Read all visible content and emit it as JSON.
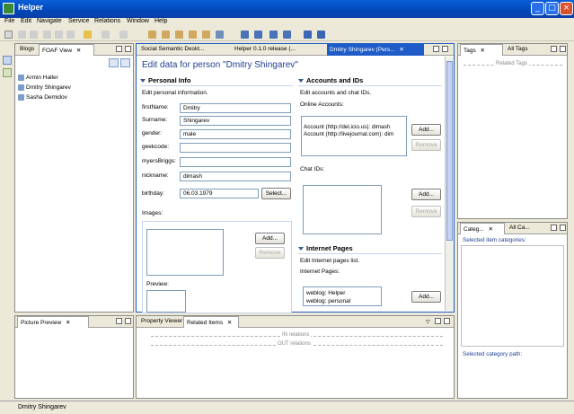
{
  "window": {
    "title": "Helper",
    "minimize": "_",
    "maximize": "□",
    "close": "×"
  },
  "menu": [
    "File",
    "Edit",
    "Navigate",
    "Service",
    "Relations",
    "Window",
    "Help"
  ],
  "left_panel": {
    "tabs": [
      "Blogs",
      "FOAF View"
    ],
    "persons": [
      "Armin Haller",
      "Dmitry Shingarev",
      "Sasha Demidov"
    ]
  },
  "editor_tabs": [
    "Social Semantic Deskt...",
    "Helper 0.1.0 release (...",
    "Dmitry Shingarev (Pers..."
  ],
  "editor": {
    "heading": "Edit data for person \"Dmitry Shingarev\"",
    "personal": {
      "title": "Personal Info",
      "desc": "Edit personal information.",
      "labels": [
        "firstName:",
        "Surname:",
        "gender:",
        "geekcode:",
        "myersBriggs:",
        "nickname:"
      ],
      "values": [
        "Dmitry",
        "Shingarev",
        "male",
        "",
        "",
        "dimash"
      ],
      "birthday_label": "birthday:",
      "birthday_value": "06.03.1979",
      "select_button": "Select...",
      "images_label": "Images:",
      "add": "Add...",
      "remove": "Remove",
      "preview_label": "Preview:"
    },
    "accounts": {
      "title": "Accounts and IDs",
      "desc": "Edit accounts and chat IDs.",
      "online_label": "Online Accounts:",
      "online_items": [
        "Account (http://del.icio.us): dimash",
        "Account (http://livejournal.com): dim"
      ],
      "add": "Add...",
      "remove": "Remove",
      "chat_label": "Chat IDs:",
      "chat_add": "Add...",
      "chat_remove": "Remove"
    },
    "internet": {
      "title": "Internet Pages",
      "desc": "Edit Internet pages list.",
      "pages_label": "Internet Pages:",
      "pages": [
        "weblog: Helper",
        "weblog: personal"
      ],
      "add": "Add..."
    }
  },
  "right_top": {
    "tabs": [
      "Tags",
      "All Tags"
    ],
    "related_tags": "Related Tags"
  },
  "right_bottom": {
    "tabs": [
      "Categ...",
      "All Ca..."
    ],
    "selected_categories": "Selected item categories:",
    "selected_path": "Selected category path:"
  },
  "bottom_left": {
    "tab": "Picture Preview"
  },
  "bottom_center": {
    "tabs": [
      "Property Viewer",
      "Related Items"
    ],
    "in_relations": "IN relations",
    "out_relations": "OUT relations"
  },
  "status": {
    "text": "Dmitry Shingarev"
  },
  "colors": {
    "title_blue": "#0a5fd8",
    "selection": "#1f5cc8",
    "heading": "#1f3f8f"
  }
}
